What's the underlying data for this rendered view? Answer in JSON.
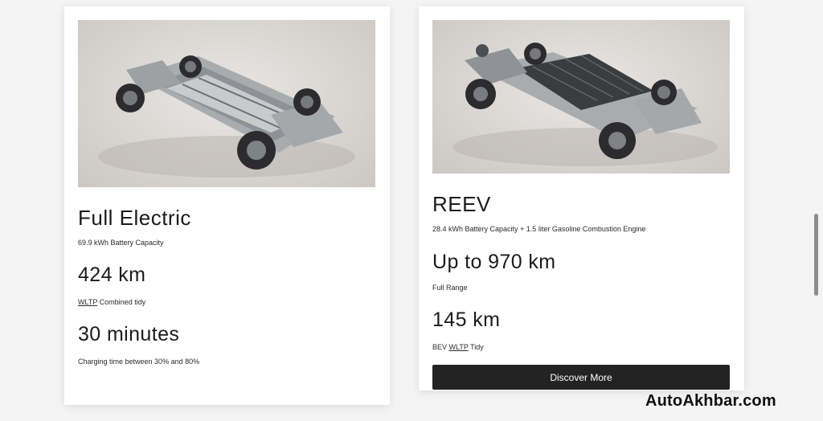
{
  "cards": [
    {
      "title": "Full Electric",
      "subtitle": "69.9 kWh Battery Capacity",
      "stat1": "424 km",
      "stat1_link": "WLTP",
      "stat1_caption": " Combined tidy",
      "stat2": "30 minutes",
      "stat2_caption": "Charging time between 30% and 80%"
    },
    {
      "title": "REEV",
      "subtitle": "28.4 kWh Battery Capacity + 1.5 liter Gasoline Combustion Engine",
      "stat1": "Up to 970 km",
      "stat1_caption": "Full Range",
      "stat2": "145 km",
      "stat2_prefix": "BEV ",
      "stat2_link": "WLTP",
      "stat2_suffix": " Tidy",
      "button_label": "Discover More"
    }
  ],
  "watermark": "AutoAkhbar.com",
  "colors": {
    "button_bg": "#232323",
    "card_bg": "#ffffff",
    "page_bg": "#f4f4f4"
  }
}
